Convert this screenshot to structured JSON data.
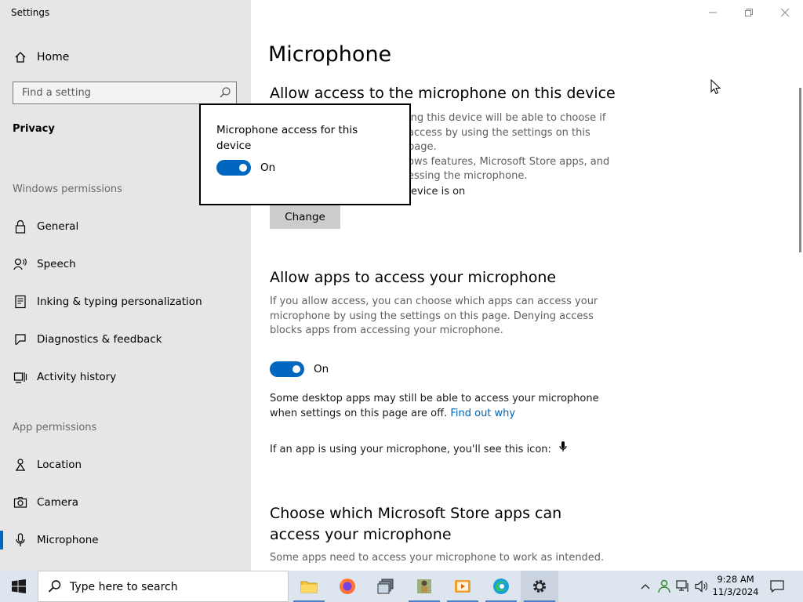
{
  "window": {
    "title": "Settings"
  },
  "sidebar": {
    "home_label": "Home",
    "search_placeholder": "Find a setting",
    "section_title": "Privacy",
    "windows_permissions_label": "Windows permissions",
    "windows_items": [
      {
        "label": "General",
        "icon": "lock-icon"
      },
      {
        "label": "Speech",
        "icon": "speech-icon"
      },
      {
        "label": "Inking & typing personalization",
        "icon": "inking-icon"
      },
      {
        "label": "Diagnostics & feedback",
        "icon": "diagnostics-icon"
      },
      {
        "label": "Activity history",
        "icon": "activity-history-icon"
      }
    ],
    "app_permissions_label": "App permissions",
    "app_items": [
      {
        "label": "Location",
        "icon": "location-icon"
      },
      {
        "label": "Camera",
        "icon": "camera-icon"
      },
      {
        "label": "Microphone",
        "icon": "microphone-icon",
        "selected": true
      }
    ]
  },
  "main": {
    "page_title": "Microphone",
    "device_section": {
      "heading": "Allow access to the microphone on this device",
      "desc_line1": "ing this device will be able to choose if",
      "desc_line2": "access by using the settings on this page.",
      "desc_line3": "ows features, Microsoft Store apps, and",
      "desc_line4": "essing the microphone.",
      "status_text": "evice is on",
      "change_button": "Change"
    },
    "apps_section": {
      "heading": "Allow apps to access your microphone",
      "description": "If you allow access, you can choose which apps can access your microphone by using the settings on this page. Denying access blocks apps from accessing your microphone.",
      "toggle_state": "On",
      "desktop_note": "Some desktop apps may still be able to access your microphone when settings on this page are off.",
      "find_out_why": "Find out why",
      "icon_note": "If an app is using your microphone, you'll see this icon:"
    },
    "store_section": {
      "heading": "Choose which Microsoft Store apps can access your microphone",
      "description": "Some apps need to access your microphone to work as intended."
    }
  },
  "popup": {
    "title": "Microphone access for this device",
    "toggle_state": "On"
  },
  "taskbar": {
    "search_placeholder": "Type here to search",
    "time": "9:28 AM",
    "date": "11/3/2024"
  },
  "colors": {
    "accent": "#0067c0",
    "link": "#0063b1",
    "sidebar_bg": "#e6e6e6",
    "taskbar_bg": "#dde6ef"
  }
}
